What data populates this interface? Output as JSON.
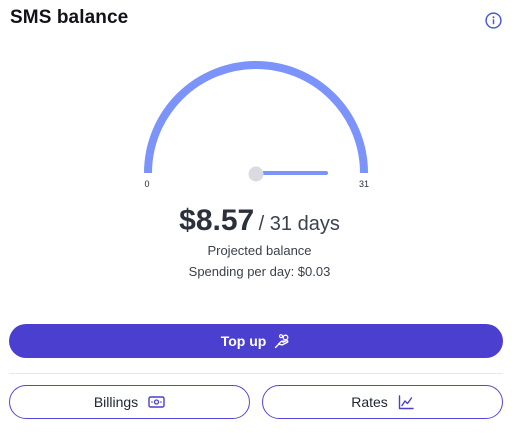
{
  "widget": {
    "title": "SMS balance",
    "info_icon": "info-icon"
  },
  "gauge": {
    "min_label": "0",
    "max_label": "31",
    "current_value": 0,
    "range": [
      0,
      31
    ],
    "arc_color": "#7b93fa",
    "needle_color": "#7b93fa",
    "hub_color": "#d9dbe0"
  },
  "summary": {
    "amount": "$8.57",
    "period": "/ 31 days",
    "projected_label": "Projected balance",
    "spending_label": "Spending per day: $0.03"
  },
  "actions": {
    "topup_label": "Top up",
    "topup_icon": "hand-coins-icon",
    "billings_label": "Billings",
    "billings_icon": "banknote-icon",
    "rates_label": "Rates",
    "rates_icon": "line-chart-icon"
  },
  "colors": {
    "primary": "#4a3fcf",
    "outline": "#5348d6",
    "info": "#4a5bd6"
  }
}
